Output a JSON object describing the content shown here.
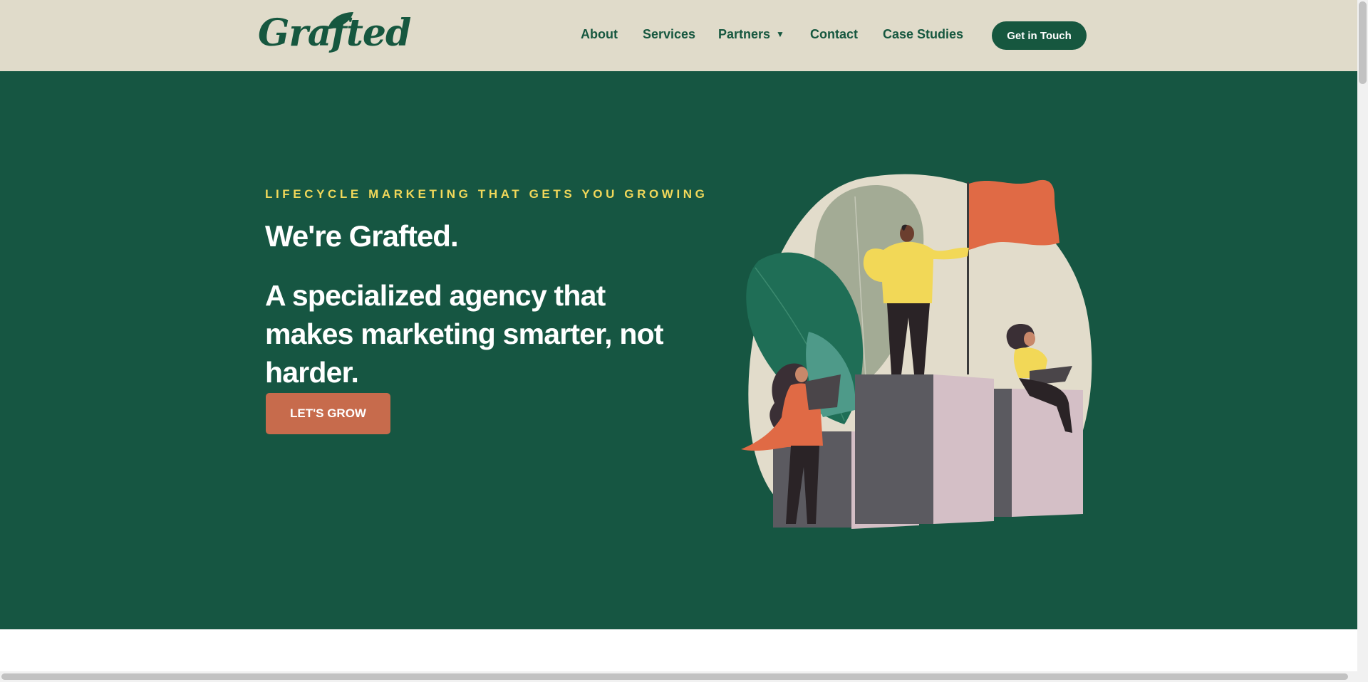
{
  "header": {
    "logo_text": "Grafted",
    "nav": [
      {
        "label": "About"
      },
      {
        "label": "Services"
      },
      {
        "label": "Partners",
        "has_dropdown": true
      },
      {
        "label": "Contact"
      },
      {
        "label": "Case Studies"
      }
    ],
    "cta_label": "Get in Touch"
  },
  "hero": {
    "eyebrow": "LIFECYCLE MARKETING THAT GETS YOU GROWING",
    "title": "We're Grafted.",
    "subtitle": "A specialized agency that makes marketing smarter, not harder.",
    "button_label": "LET'S GROW",
    "illustration": "team-on-podium-with-flag-illustration"
  },
  "icons": {
    "dropdown": "chevron-down-icon"
  },
  "colors": {
    "header_bg": "#e0dbca",
    "brand_green": "#16573f",
    "hero_bg": "#165642",
    "eyebrow_yellow": "#f1d85a",
    "button_orange": "#c76b4c",
    "flag_orange": "#e06a45"
  }
}
